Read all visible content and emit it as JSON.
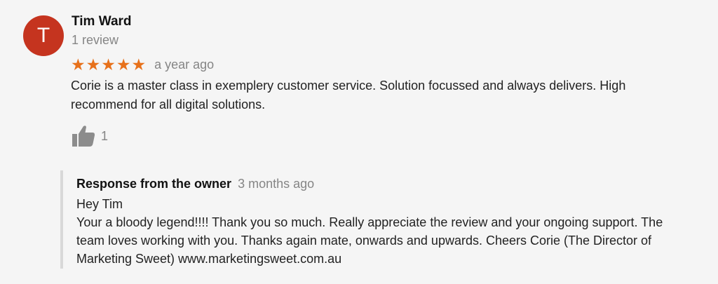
{
  "review": {
    "avatar_letter": "T",
    "avatar_color": "#c5341f",
    "author_name": "Tim Ward",
    "review_count": "1 review",
    "rating": 5,
    "rating_max": 5,
    "star_color": "#e7711b",
    "timestamp": "a year ago",
    "text": "Corie is a master class in exemplery customer service. Solution focussed and always delivers. High recommend for all digital solutions.",
    "like_icon": "thumbs-up-icon",
    "like_count": "1"
  },
  "owner_response": {
    "title": "Response from the owner",
    "timestamp": "3 months ago",
    "greeting": "Hey Tim",
    "body": "Your a bloody legend!!!! Thank you so much. Really appreciate the review and your ongoing support. The team loves working with you. Thanks again mate, onwards and upwards. Cheers Corie (The Director of Marketing Sweet) www.marketingsweet.com.au"
  }
}
